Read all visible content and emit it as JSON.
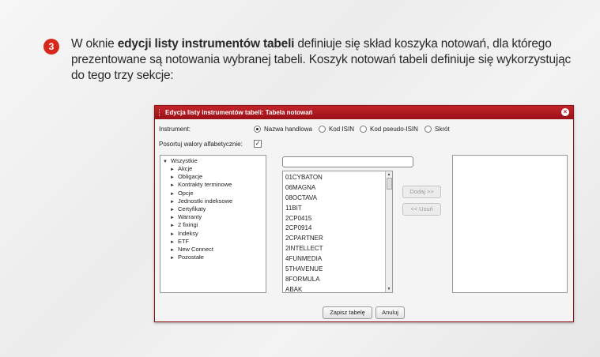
{
  "step": {
    "number": "3"
  },
  "intro": {
    "pre": "W oknie ",
    "bold": "edycji listy instrumentów tabeli",
    "post": " definiuje się skład koszyka notowań, dla którego prezentowane są notowania wybranej tabeli. Koszyk notowań tabeli definiuje się wykorzystując do tego trzy sekcje:"
  },
  "dialog": {
    "title": "Edycja listy instrumentów tabeli: Tabela notowań",
    "close_icon": "close-icon",
    "instrument_label": "Instrument:",
    "radio_options": [
      {
        "label": "Nazwa handlowa",
        "selected": true
      },
      {
        "label": "Kod ISIN",
        "selected": false
      },
      {
        "label": "Kod pseudo-ISIN",
        "selected": false
      },
      {
        "label": "Skrót",
        "selected": false
      }
    ],
    "sort_label": "Posortuj walory alfabetycznie:",
    "sort_checked": "✓",
    "tree": {
      "root": "Wszystkie",
      "children": [
        "Akcje",
        "Obligacje",
        "Kontrakty terminowe",
        "Opcje",
        "Jednostki indeksowe",
        "Certyfikaty",
        "Warranty",
        "2 fixingi",
        "Indeksy",
        "ETF",
        "New Connect",
        "Pozostałe"
      ]
    },
    "search": {
      "value": "",
      "placeholder": ""
    },
    "instruments": [
      "01CYBATON",
      "06MAGNA",
      "08OCTAVA",
      "11BIT",
      "2CP0415",
      "2CP0914",
      "2CPARTNER",
      "2INTELLECT",
      "4FUNMEDIA",
      "5THAVENUE",
      "8FORMULA",
      "ABAK"
    ],
    "add_button": "Dodaj >>",
    "remove_button": "<< Usuń",
    "save_button": "Zapisz tabelę",
    "cancel_button": "Anuluj"
  },
  "colors": {
    "accent": "#d7281d",
    "titlebar": "#b31a20"
  }
}
